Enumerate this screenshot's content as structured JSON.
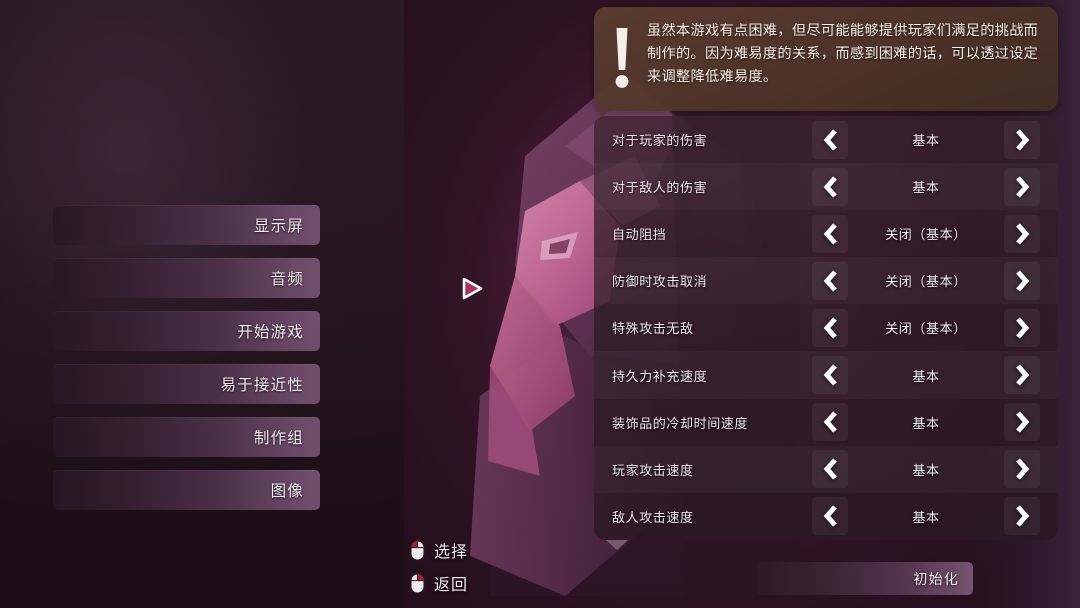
{
  "sidebar": {
    "items": [
      {
        "label": "显示屏",
        "name": "display"
      },
      {
        "label": "音频",
        "name": "audio"
      },
      {
        "label": "开始游戏",
        "name": "start-game"
      },
      {
        "label": "易于接近性",
        "name": "accessibility"
      },
      {
        "label": "制作组",
        "name": "credits"
      },
      {
        "label": "图像",
        "name": "graphics"
      }
    ]
  },
  "tooltip": {
    "icon": "exclamation-icon",
    "text": "虽然本游戏有点困难，但尽可能能够提供玩家们满足的挑战而制作的。因为难易度的关系，而感到困难的话，可以透过设定来调整降低难易度。"
  },
  "settings": {
    "left_arrow_icon": "chevron-left-icon",
    "right_arrow_icon": "chevron-right-icon",
    "rows": [
      {
        "label": "对于玩家的伤害",
        "value": "基本"
      },
      {
        "label": "对于敌人的伤害",
        "value": "基本"
      },
      {
        "label": "自动阻挡",
        "value": "关闭（基本）"
      },
      {
        "label": "防御时攻击取消",
        "value": "关闭（基本）"
      },
      {
        "label": "特殊攻击无敌",
        "value": "关闭（基本）"
      },
      {
        "label": "持久力补充速度",
        "value": "基本"
      },
      {
        "label": "装饰品的冷却时间速度",
        "value": "基本"
      },
      {
        "label": "玩家攻击速度",
        "value": "基本"
      },
      {
        "label": "敌人攻击速度",
        "value": "基本"
      }
    ]
  },
  "reset": {
    "label": "初始化"
  },
  "prompts": [
    {
      "icon": "mouse-left-click-icon",
      "label": "选择"
    },
    {
      "icon": "mouse-right-click-icon",
      "label": "返回"
    }
  ],
  "cursor": {
    "icon": "triangle-cursor-icon"
  },
  "colors": {
    "tooltip_bg": "#5c3e30",
    "panel_bg": "#3a232e",
    "accent_pink": "#c2527f",
    "text_light": "#f2eaf0",
    "mouse_highlight": "#a81f2d"
  }
}
